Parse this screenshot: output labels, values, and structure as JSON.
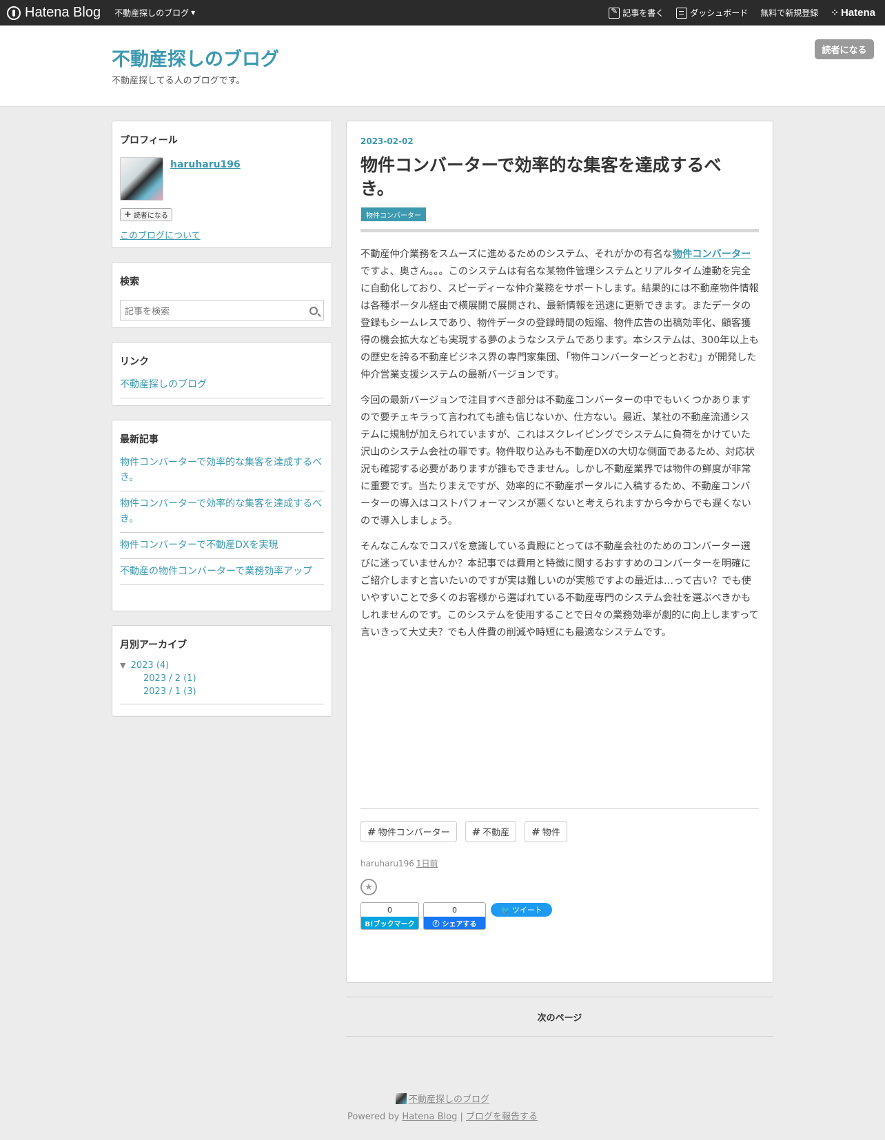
{
  "topbar": {
    "logo": "Hatena Blog",
    "blog_menu": "不動産探しのブログ",
    "write": "記事を書く",
    "dashboard": "ダッシュボード",
    "signup": "無料で新規登録",
    "hatena": "Hatena"
  },
  "header": {
    "title": "不動産探しのブログ",
    "description": "不動産探してる人のブログです。",
    "subscribe": "読者になる"
  },
  "sidebar": {
    "profile": {
      "heading": "プロフィール",
      "username": "haruharu196",
      "subscribe": "読者になる",
      "about": "このブログについて"
    },
    "search": {
      "heading": "検索",
      "placeholder": "記事を検索"
    },
    "links": {
      "heading": "リンク",
      "items": [
        "不動産探しのブログ"
      ]
    },
    "recent": {
      "heading": "最新記事",
      "items": [
        "物件コンバーターで効率的な集客を達成するべき。",
        "物件コンバーターで効率的な集客を達成するべき。",
        "物件コンバーターで不動産DXを実現",
        "不動産の物件コンバーターで業務効率アップ"
      ]
    },
    "archive": {
      "heading": "月別アーカイブ",
      "year": "2023 (4)",
      "months": [
        "2023 / 2 (1)",
        "2023 / 1 (3)"
      ]
    }
  },
  "entry": {
    "date": "2023-02-02",
    "title": "物件コンバーターで効率的な集客を達成するべき。",
    "category": "物件コンバーター",
    "p1": {
      "a": "不動産仲介業務をスムーズに進めるためのシステム、それがかの有名な",
      "keyword": "物件コンバーター",
      "b": "ですよ、奥さん。。。このシステムは有名な某物件管理システムとリアルタイム連動を完全に自動化しており、スピーディーな仲介業務をサポートします。結果的には不動産物件情報は各種ポータル経由で横展開で展開され、最新情報を迅速に更新できます。またデータの登録もシームレスであり、物件データの登録時間の短縮、物件広告の出稿効率化、顧客獲得の機会拡大なども実現する夢のようなシステムであります。本システムは、300年以上もの歴史を誇る不動産ビジネス界の専門家集団、「物件コンバーターどっとおむ」が開発した仲介営業支援システムの最新バージョンです。"
    },
    "p2": "今回の最新バージョンで注目すべき部分は不動産コンバーターの中でもいくつかありますので要チェキラって言われても誰も信じないか、仕方ない。最近、某社の不動産流通システムに規制が加えられていますが、これはスクレイピングでシステムに負荷をかけていた沢山のシステム会社の罪です。物件取り込みも不動産DXの大切な側面であるため、対応状況も確認する必要がありますが誰もできません。しかし不動産業界では物件の鮮度が非常に重要です。当たりまえですが、効率的に不動産ポータルに入稿するため、不動産コンバーターの導入はコストパフォーマンスが悪くないと考えられますから今からでも遅くないので導入しましょう。",
    "p3": "そんなこんなでコスパを意識している貴殿にとっては不動産会社のためのコンバーター選びに迷っていませんか？本記事では費用と特徴に関するおすすめのコンバーターを明確にご紹介しますと言いたいのですが実は難しいのが実態ですよの最近は…って古い？でも使いやすいことで多くのお客様から選ばれている不動産専門のシステム会社を選ぶべきかもしれませんのです。このシステムを使用することで日々の業務効率が劇的に向上しますって言いきって大丈夫？でも人件費の削減や時短にも最適なシステムです。",
    "tags": [
      "物件コンバーター",
      "不動産",
      "物件"
    ],
    "author": "haruharu196",
    "ago": "1日前",
    "share": {
      "hatena_count": "0",
      "hatena_label": "B!ブックマーク",
      "fb_count": "0",
      "fb_label": "シェアする",
      "tweet": "ツイート"
    }
  },
  "pager": {
    "next": "次のページ"
  },
  "footer": {
    "blog": "不動産探しのブログ",
    "powered": "Powered by",
    "hatena_blog": "Hatena Blog",
    "sep": "|",
    "report": "ブログを報告する"
  }
}
